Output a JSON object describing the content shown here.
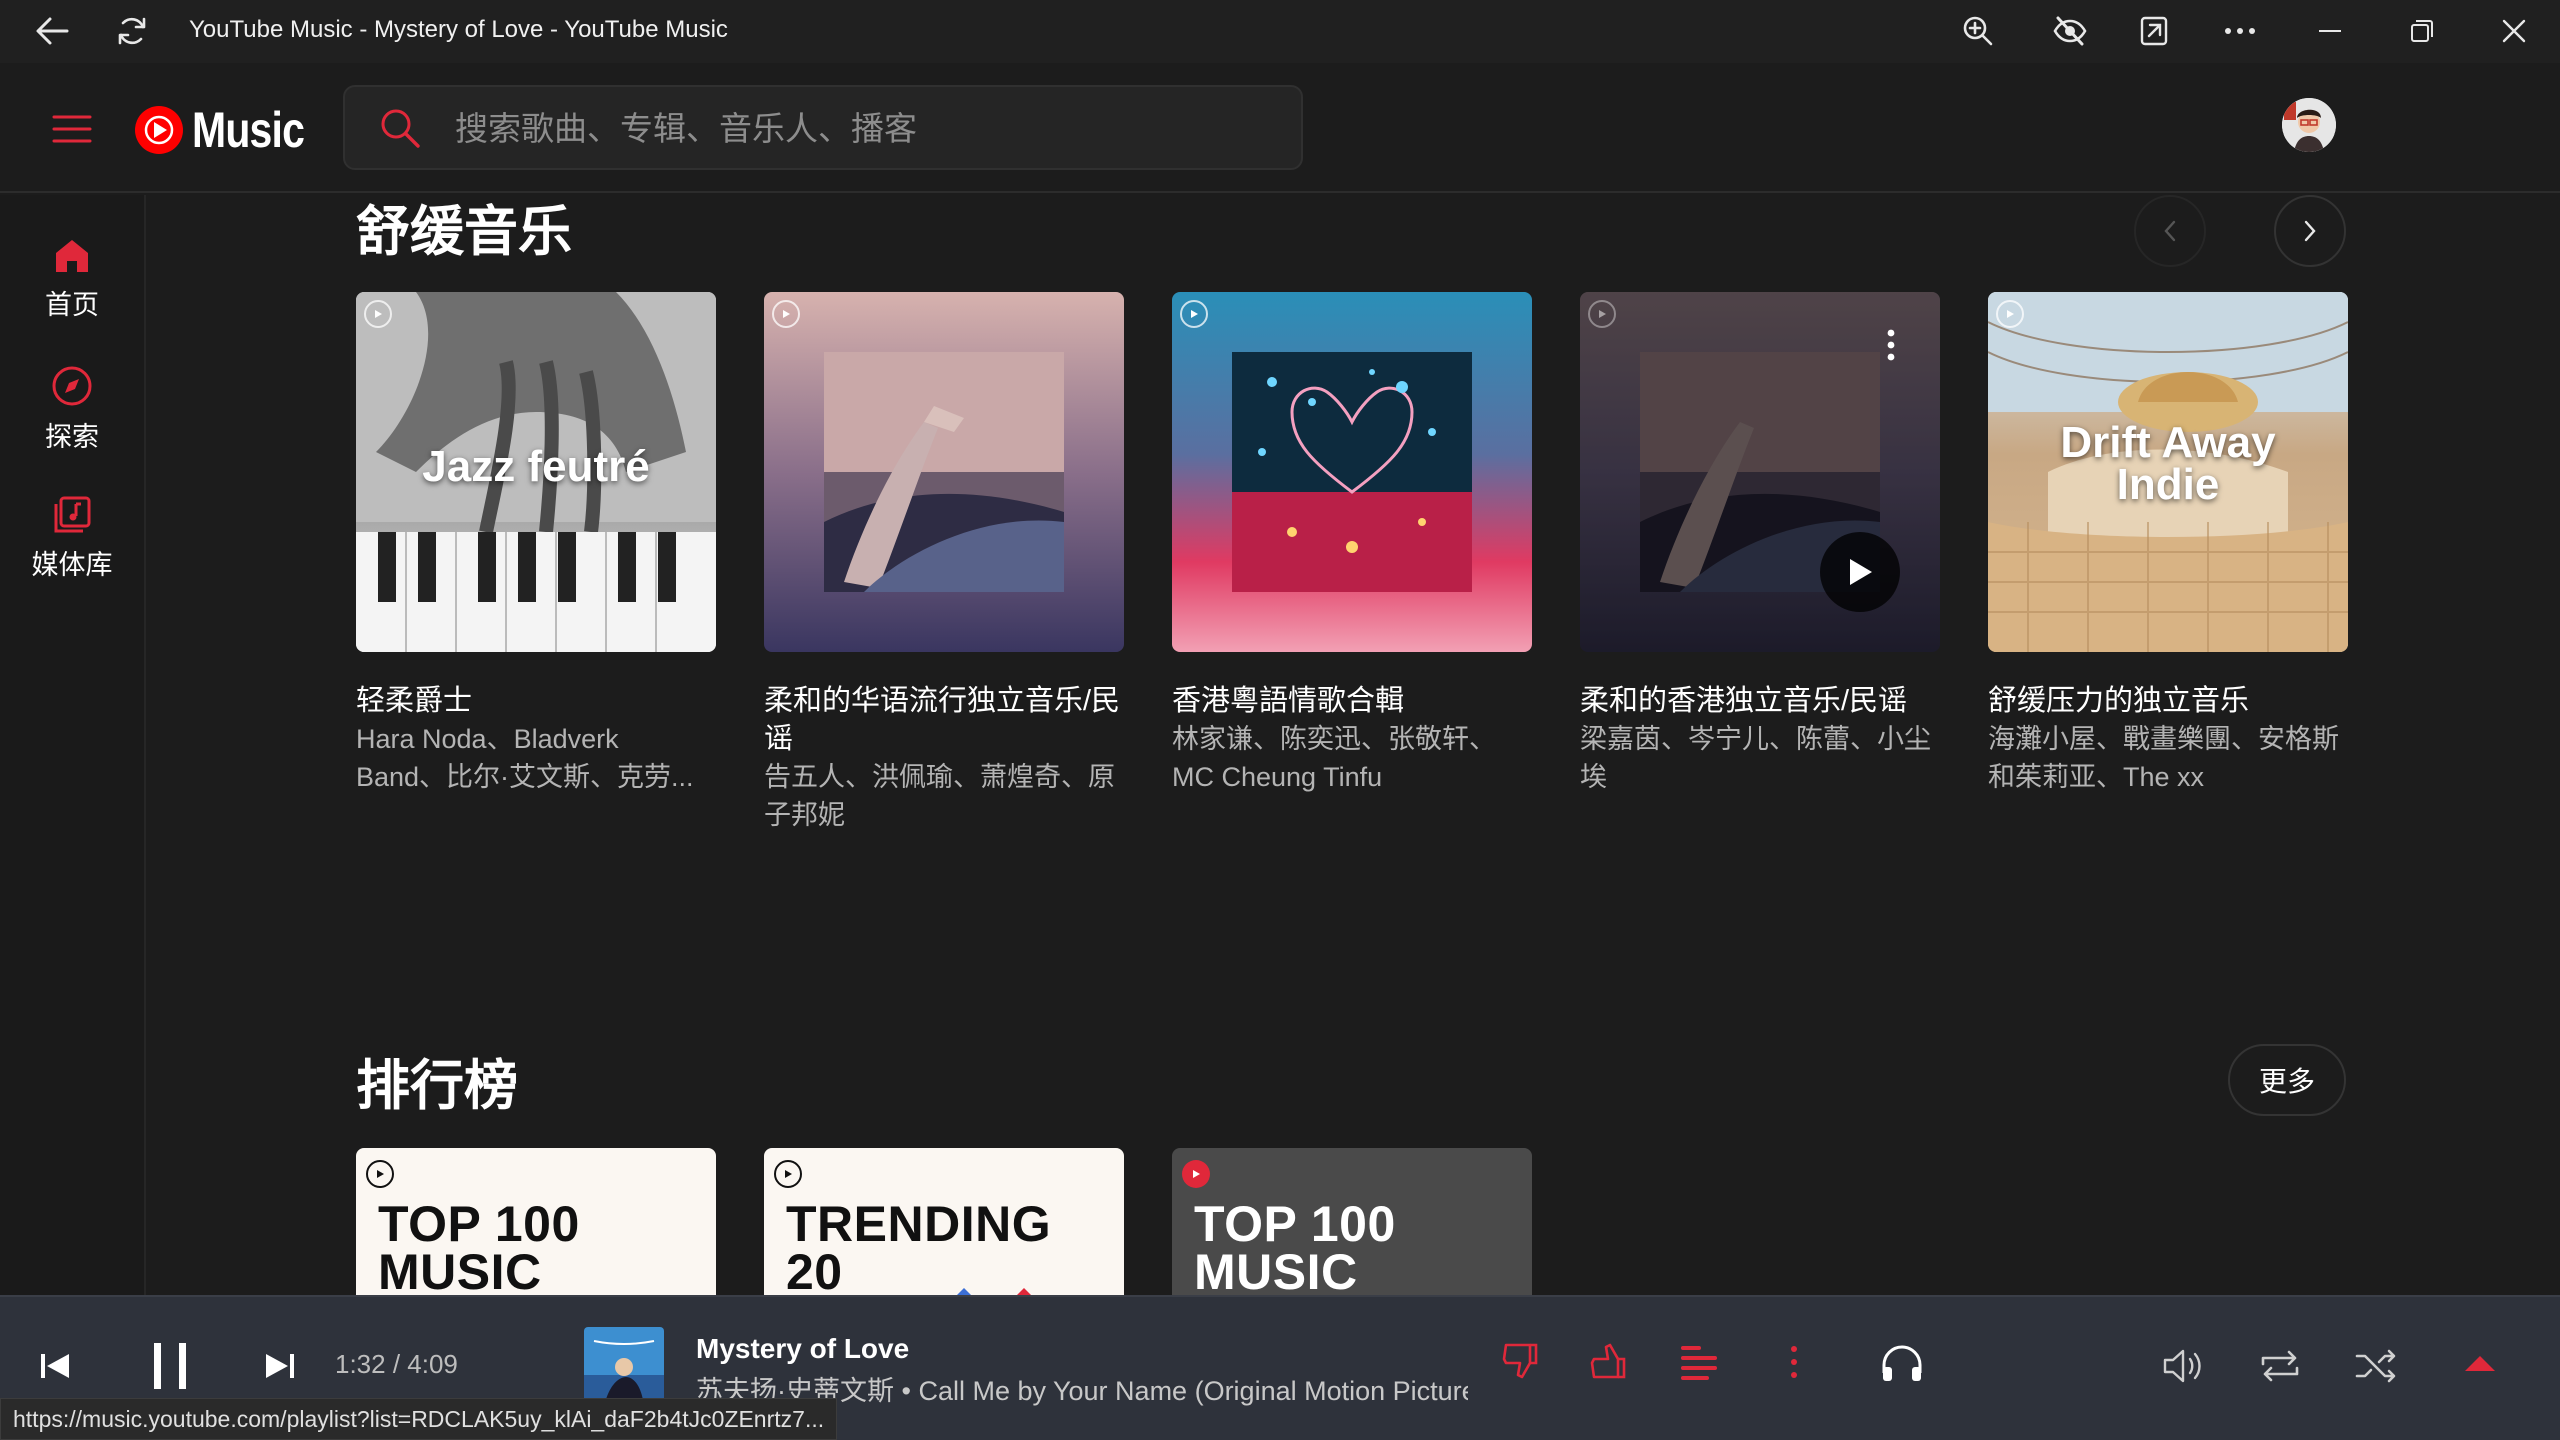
{
  "window": {
    "title": "YouTube Music - Mystery of Love - YouTube Music"
  },
  "header": {
    "logo_text": "Music",
    "search_placeholder": "搜索歌曲、专辑、音乐人、播客"
  },
  "sidebar": {
    "items": [
      {
        "label": "首页",
        "icon": "home-icon",
        "active": true
      },
      {
        "label": "探索",
        "icon": "compass-icon",
        "active": false
      },
      {
        "label": "媒体库",
        "icon": "library-icon",
        "active": false
      }
    ]
  },
  "sections": {
    "relax": {
      "title": "舒缓音乐",
      "cards": [
        {
          "title": "轻柔爵士",
          "subtitle": "Hara Noda、Bladverk Band、比尔·艾文斯、克劳...",
          "overlay": "Jazz feutré"
        },
        {
          "title": "柔和的华语流行独立音乐/民谣",
          "subtitle": "告五人、洪佩瑜、萧煌奇、原子邦妮",
          "overlay": ""
        },
        {
          "title": "香港粵語情歌合輯",
          "subtitle": "林家谦、陈奕迅、张敬轩、MC Cheung Tinfu",
          "overlay": ""
        },
        {
          "title": "柔和的香港独立音乐/民谣",
          "subtitle": "梁嘉茵、岑宁儿、陈蕾、小尘埃",
          "overlay": ""
        },
        {
          "title": "舒缓压力的独立音乐",
          "subtitle": "海灘小屋、戰畫樂團、安格斯和茱莉亚、The xx",
          "overlay_line1": "Drift Away",
          "overlay_line2": "Indie"
        }
      ]
    },
    "charts": {
      "title": "排行榜",
      "more_label": "更多",
      "cards": [
        {
          "line1": "TOP 100",
          "line2": "MUSIC VIDEOS"
        },
        {
          "line1": "TRENDING",
          "line2": "20"
        },
        {
          "line1": "TOP 100",
          "line2": "MUSIC VIDEOS"
        }
      ]
    }
  },
  "player": {
    "time": "1:32 / 4:09",
    "track_title": "Mystery of Love",
    "track_subtitle": "苏夫扬·史蒂文斯 • Call Me by Your Name (Original Motion Picture Soundtrack)",
    "accent_color": "#e0283a"
  },
  "status_url": "https://music.youtube.com/playlist?list=RDCLAK5uy_klAi_daF2b4tJc0ZEnrtz7..."
}
